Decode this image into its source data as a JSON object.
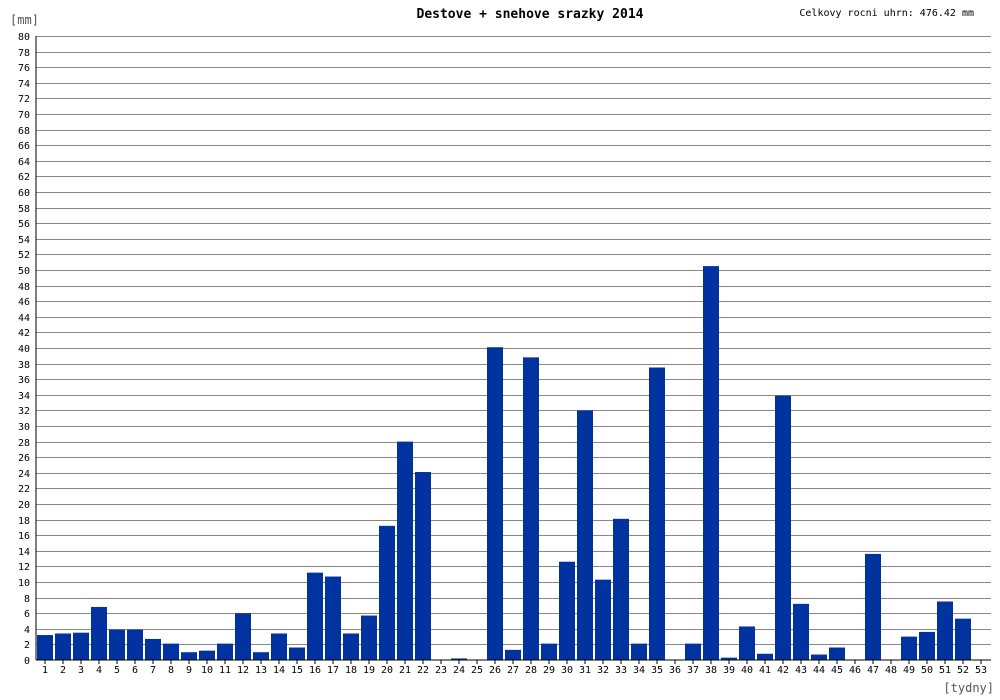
{
  "chart_data": {
    "type": "bar",
    "title": "Destove + snehove srazky 2014",
    "annotation": "Celkovy rocni uhrn: 476.42 mm",
    "ylabel": "[mm]",
    "xlabel": "[tydny]",
    "ylim": [
      0,
      80
    ],
    "y_tick_step": 2,
    "grid": true,
    "bar_color": "#0033a0",
    "categories": [
      "1",
      "2",
      "3",
      "4",
      "5",
      "6",
      "7",
      "8",
      "9",
      "10",
      "11",
      "12",
      "13",
      "14",
      "15",
      "16",
      "17",
      "18",
      "19",
      "20",
      "21",
      "22",
      "23",
      "24",
      "25",
      "26",
      "27",
      "28",
      "29",
      "30",
      "31",
      "32",
      "33",
      "34",
      "35",
      "36",
      "37",
      "38",
      "39",
      "40",
      "41",
      "42",
      "43",
      "44",
      "45",
      "46",
      "47",
      "48",
      "49",
      "50",
      "51",
      "52",
      "53"
    ],
    "values": [
      3.2,
      3.4,
      3.5,
      6.8,
      3.9,
      3.9,
      2.7,
      2.1,
      1.0,
      1.2,
      2.1,
      6.0,
      1.0,
      3.4,
      1.6,
      11.2,
      10.7,
      3.4,
      5.7,
      17.2,
      28.0,
      24.1,
      0,
      0.2,
      0,
      40.1,
      1.3,
      38.8,
      2.1,
      12.6,
      32.0,
      10.3,
      18.1,
      2.1,
      37.5,
      0,
      2.1,
      50.5,
      0.3,
      4.3,
      0.8,
      33.9,
      7.2,
      0.7,
      1.6,
      0,
      13.6,
      0,
      3.0,
      3.6,
      7.5,
      5.3,
      0
    ]
  }
}
